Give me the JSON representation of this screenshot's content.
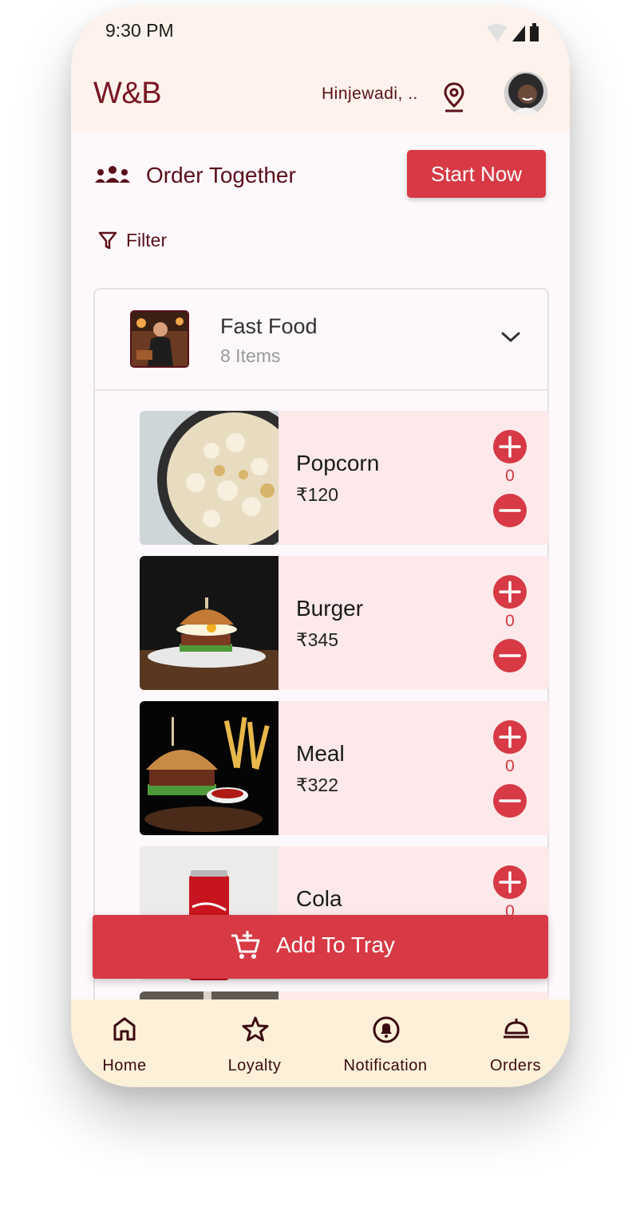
{
  "status_bar": {
    "time": "9:30 PM"
  },
  "header": {
    "logo": "W&B",
    "location": "Hinjewadi, .."
  },
  "order_together": {
    "label": "Order Together",
    "button": "Start Now"
  },
  "filter": {
    "label": "Filter"
  },
  "category": {
    "title": "Fast Food",
    "subtitle": "8 Items"
  },
  "items": [
    {
      "name": "Popcorn",
      "price": "₹120",
      "qty": "0"
    },
    {
      "name": "Burger",
      "price": "₹345",
      "qty": "0"
    },
    {
      "name": "Meal",
      "price": "₹322",
      "qty": "0"
    },
    {
      "name": "Cola",
      "price": "",
      "qty": "0"
    }
  ],
  "tray": {
    "label": "Add To Tray"
  },
  "bottom_nav": [
    {
      "label": "Home",
      "icon": "home-icon"
    },
    {
      "label": "Loyalty",
      "icon": "star-icon"
    },
    {
      "label": "Notification",
      "icon": "bell-icon"
    },
    {
      "label": "Orders",
      "icon": "cloche-icon"
    }
  ],
  "colors": {
    "accent": "#d73945",
    "brand": "#7a1623",
    "item_bg": "#fde9e9",
    "nav_bg": "#fdf0d8",
    "top_bg": "#fdf3ec"
  }
}
